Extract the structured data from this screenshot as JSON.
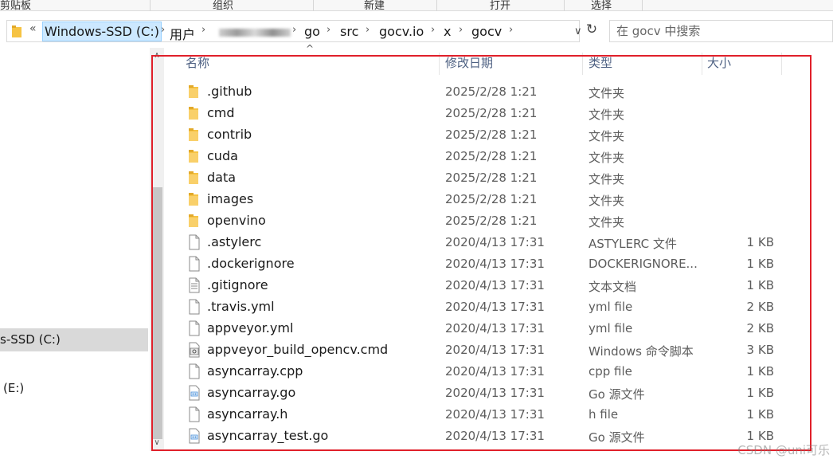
{
  "ribbon": {
    "groups": [
      "剪贴板",
      "组织",
      "新建",
      "打开",
      "选择"
    ]
  },
  "address": {
    "overflow_chevron": "«",
    "crumbs": [
      "Windows-SSD (C:)",
      "用户",
      "go",
      "src",
      "gocv.io",
      "x",
      "gocv"
    ],
    "separator": "›",
    "dropdown_glyph": "∨",
    "refresh_glyph": "↻"
  },
  "search": {
    "placeholder": "在 gocv 中搜索"
  },
  "nav": {
    "items": [
      "s-SSD (C:)",
      "(E:)"
    ]
  },
  "columns": {
    "name": "名称",
    "modified": "修改日期",
    "type": "类型",
    "size": "大小"
  },
  "files": [
    {
      "name": ".github",
      "modified": "2025/2/28 1:21",
      "type": "文件夹",
      "size": "",
      "icon": "folder-icon"
    },
    {
      "name": "cmd",
      "modified": "2025/2/28 1:21",
      "type": "文件夹",
      "size": "",
      "icon": "folder-icon"
    },
    {
      "name": "contrib",
      "modified": "2025/2/28 1:21",
      "type": "文件夹",
      "size": "",
      "icon": "folder-icon"
    },
    {
      "name": "cuda",
      "modified": "2025/2/28 1:21",
      "type": "文件夹",
      "size": "",
      "icon": "folder-icon"
    },
    {
      "name": "data",
      "modified": "2025/2/28 1:21",
      "type": "文件夹",
      "size": "",
      "icon": "folder-icon"
    },
    {
      "name": "images",
      "modified": "2025/2/28 1:21",
      "type": "文件夹",
      "size": "",
      "icon": "folder-icon"
    },
    {
      "name": "openvino",
      "modified": "2025/2/28 1:21",
      "type": "文件夹",
      "size": "",
      "icon": "folder-icon"
    },
    {
      "name": ".astylerc",
      "modified": "2020/4/13 17:31",
      "type": "ASTYLERC 文件",
      "size": "1 KB",
      "icon": "file-icon"
    },
    {
      "name": ".dockerignore",
      "modified": "2020/4/13 17:31",
      "type": "DOCKERIGNORE...",
      "size": "1 KB",
      "icon": "file-icon"
    },
    {
      "name": ".gitignore",
      "modified": "2020/4/13 17:31",
      "type": "文本文档",
      "size": "1 KB",
      "icon": "text-file-icon"
    },
    {
      "name": ".travis.yml",
      "modified": "2020/4/13 17:31",
      "type": "yml file",
      "size": "2 KB",
      "icon": "file-icon"
    },
    {
      "name": "appveyor.yml",
      "modified": "2020/4/13 17:31",
      "type": "yml file",
      "size": "2 KB",
      "icon": "file-icon"
    },
    {
      "name": "appveyor_build_opencv.cmd",
      "modified": "2020/4/13 17:31",
      "type": "Windows 命令脚本",
      "size": "3 KB",
      "icon": "script-file-icon"
    },
    {
      "name": "asyncarray.cpp",
      "modified": "2020/4/13 17:31",
      "type": "cpp file",
      "size": "1 KB",
      "icon": "file-icon"
    },
    {
      "name": "asyncarray.go",
      "modified": "2020/4/13 17:31",
      "type": "Go 源文件",
      "size": "1 KB",
      "icon": "go-file-icon"
    },
    {
      "name": "asyncarray.h",
      "modified": "2020/4/13 17:31",
      "type": "h file",
      "size": "1 KB",
      "icon": "file-icon"
    },
    {
      "name": "asyncarray_test.go",
      "modified": "2020/4/13 17:31",
      "type": "Go 源文件",
      "size": "1 KB",
      "icon": "go-file-icon"
    }
  ],
  "watermark": "CSDN @uni可乐",
  "colors": {
    "highlight_border": "#e0202a",
    "folder": "#f6c343",
    "selection": "#cce8ff"
  }
}
